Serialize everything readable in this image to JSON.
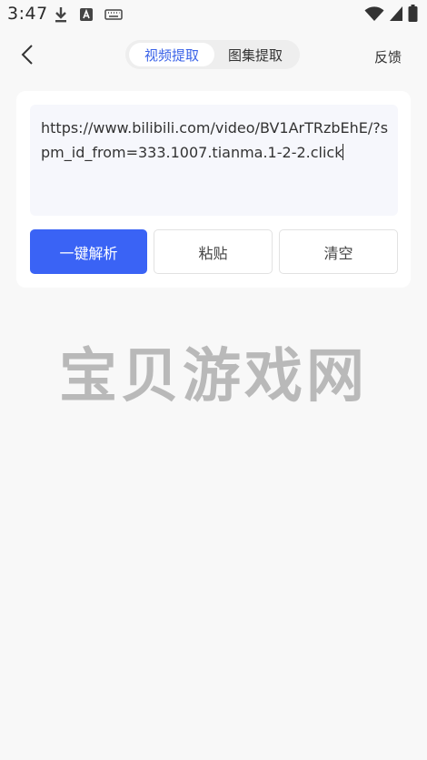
{
  "status_bar": {
    "time": "3:47",
    "icons": [
      "download-icon",
      "a-box-icon",
      "keyboard-icon",
      "wifi-icon",
      "signal-icon",
      "battery-icon"
    ]
  },
  "topbar": {
    "back_icon": "chevron-left-icon",
    "tabs": [
      {
        "label": "视频提取",
        "active": true
      },
      {
        "label": "图集提取",
        "active": false
      }
    ],
    "feedback_label": "反馈"
  },
  "input": {
    "value": "https://www.bilibili.com/video/BV1ArTRzbEhE/?spm_id_from=333.1007.tianma.1-2-2.click"
  },
  "buttons": {
    "parse": "一键解析",
    "paste": "粘贴",
    "clear": "清空"
  },
  "watermark": "宝贝游戏网",
  "colors": {
    "accent": "#3a63f5",
    "tab_active_text": "#3b63e8",
    "background": "#f8f8f8"
  }
}
